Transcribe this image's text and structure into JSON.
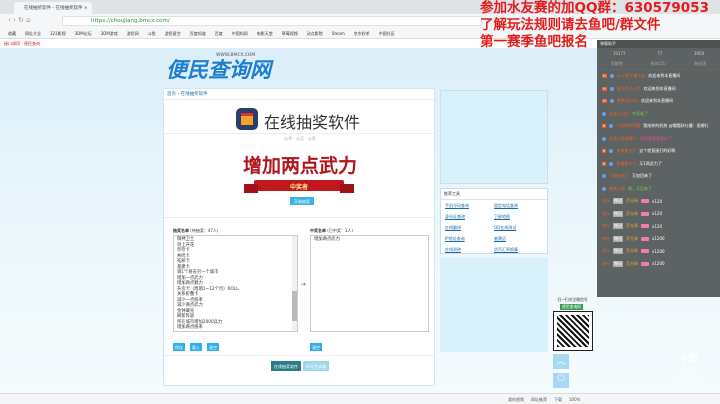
{
  "browser": {
    "tab_title": "在线抽奖软件 - 在线抽奖软件",
    "url": "https://choujiang.bmcx.com/",
    "bookmarks": [
      "收藏",
      "网址大全",
      "321影视",
      "3DM论坛",
      "3DM游戏",
      "游民网",
      "斗鱼",
      "游民星空",
      "百度知道",
      "百度",
      "中国知网",
      "电影天堂",
      "草莓视频",
      "动点影院",
      "Steam",
      "京东秒杀",
      "中国社区"
    ],
    "sub_links": [
      "接口调用",
      "便民查询"
    ]
  },
  "overlay_text": [
    "参加水友赛的加QQ群：630579053",
    "了解玩法规则请去鱼吧/群文件",
    "第一赛季鱼吧报名"
  ],
  "site": {
    "logo": "便民查询网",
    "logo_url": "WWW.BMCX.COM",
    "breadcrumb": [
      "首页",
      "在线抽奖软件"
    ],
    "title": "在线抽奖软件",
    "slogan": "公平 · 公正 · 公开",
    "prize": "增加两点武力",
    "ribbon": "中奖者",
    "start_button": "开始抽奖",
    "list_label": "抽奖名单",
    "list_count": "(待抽奖：47人)",
    "winner_label": "中奖名单",
    "winner_count": "(已中奖：1人)",
    "list_items": [
      "御神卫士",
      "剑上开花",
      "奈奈卡",
      "共鸣卡",
      "祛邪卡",
      "基建卡",
      "调1个将去另一个城市",
      "增加一点武力",
      "增加两点魅力",
      "升次卡（周期1~12个月）ROLL",
      "关系折叠卡",
      "减少一点统率",
      "减少两点武力",
      "金钟罩壳",
      "刷新阵容",
      "所在城市增加2000兵力",
      "增加两点统率"
    ],
    "winners": "增加两点武力",
    "buttons": {
      "save": "保存",
      "import": "载入",
      "clear": "清空",
      "clear2": "清空"
    },
    "footer_buttons": [
      "在线抽奖软件",
      "序号生成器"
    ]
  },
  "sidebar": {
    "tools_title": "推荐工具",
    "tools": [
      "手机号码查询",
      "固定电话查询",
      "身份证查询",
      "卫星地图",
      "在线翻译",
      "QQ在线测试",
      "IP地址查询",
      "者黄历",
      "在线闹钟",
      "货币汇率换算"
    ],
    "qr_text": "扫一扫关注微信号",
    "qr_name": "便民查询网"
  },
  "chat": {
    "title": "弹幕助手",
    "stats": [
      "19177",
      "77",
      "3950"
    ],
    "tabs": [
      "贡献榜",
      "贵宾(21)",
      "粉丝团"
    ],
    "messages": [
      {
        "badge": "H",
        "user": "Lv斗鱼主播水友",
        "text": "欢迎来到本直播间",
        "c": "w"
      },
      {
        "badge": "H",
        "user": "蛋白质之火花",
        "text": "欢迎来到本直播间",
        "c": "w"
      },
      {
        "badge": "H",
        "user": "桐梦瑶Lxxx",
        "text": "欢迎来到本直播间",
        "c": "w"
      },
      {
        "badge": "",
        "user": "水晶小白白",
        "text": "中奖者了",
        "c": "g"
      },
      {
        "badge": "K",
        "user": "二分钟的荒野",
        "text": "我给你的奶热 @帽帽好吐槽：说哪行",
        "c": "w"
      },
      {
        "badge": "",
        "user": "女孩日常收藏人",
        "text": "说的我看我都好了",
        "c": "p"
      },
      {
        "badge": "K",
        "user": "幸福猪太子",
        "text": "这个就直接打的好啊",
        "c": "w"
      },
      {
        "badge": "K",
        "user": "幸福猪太子",
        "text": "又1两武力了",
        "c": "w"
      },
      {
        "badge": "",
        "user": "小猫吃笔了",
        "text": "又加回来了",
        "c": "w"
      },
      {
        "badge": "",
        "user": "晓晓小猫",
        "text": "嗯，又回来了",
        "c": "g"
      }
    ],
    "gifts": [
      {
        "user": "老叶",
        "send": "赠送",
        "gift": "荧光棒",
        "count": "x120"
      },
      {
        "user": "老叶",
        "send": "赠送",
        "gift": "荧光棒",
        "count": "x120"
      },
      {
        "user": "老叶",
        "send": "赠送",
        "gift": "荧光棒",
        "count": "x120"
      },
      {
        "user": "老叶",
        "send": "赠送",
        "gift": "荧光棒",
        "count": "x1200"
      },
      {
        "user": "老叶",
        "send": "赠送",
        "gift": "荧光棒",
        "count": "x1200"
      },
      {
        "user": "老叶",
        "send": "赠送",
        "gift": "荧光棒",
        "count": "x1200"
      }
    ]
  },
  "statusbar": [
    "我的视频",
    "网址推荐",
    "下载",
    "100%"
  ],
  "watermark": [
    "斗鱼",
    "房间号",
    "3410320"
  ]
}
